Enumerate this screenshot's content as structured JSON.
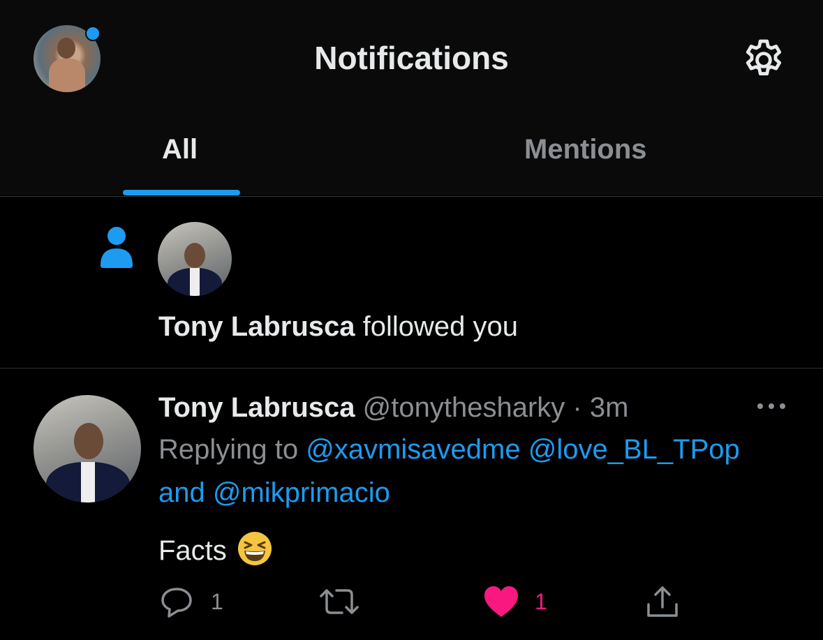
{
  "header": {
    "title": "Notifications"
  },
  "tabs": [
    {
      "label": "All",
      "active": true
    },
    {
      "label": "Mentions",
      "active": false
    }
  ],
  "colors": {
    "accent": "#1d9bf0",
    "like": "#f91880",
    "background": "#000000"
  },
  "follow_notification": {
    "icon": "person-icon",
    "user_name": "Tony Labrusca",
    "action_text": " followed you"
  },
  "tweet": {
    "user_name": "Tony Labrusca",
    "handle": "@tonythesharky",
    "separator": " · ",
    "time": "3m",
    "replying_prefix": "Replying to ",
    "mention_1": "@xavmisavedme",
    "mention_2": "@love_BL_TPop",
    "and_text": "and ",
    "mention_3": "@mikprimacio",
    "text": "Facts",
    "emoji": "grinning-squinting-face-emoji",
    "reply_count": "1",
    "retweet_count": "",
    "like_count": "1"
  }
}
